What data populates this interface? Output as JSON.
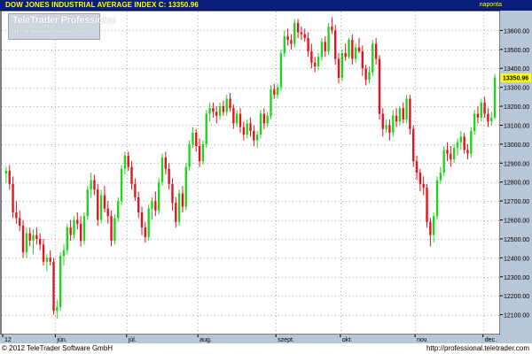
{
  "header": {
    "instrument": "DOW JONES INDUSTRIAL AVERAGE INDEX",
    "close_label": "C:",
    "close_value": "13350.96",
    "period": "naponta"
  },
  "logo": {
    "name": "TeleTrader Professional",
    "url": "http://professional.teletrader.com"
  },
  "footer": {
    "copyright": "© 2012 TeleTrader Software GmbH",
    "url": "http://professional.teletrader.com"
  },
  "colors": {
    "up": "#1fd41f",
    "down": "#e8101c",
    "title_bg": "#0b1f7a",
    "title_text": "#ffff00",
    "axis_bg": "#b8c6d8",
    "last_price_bg": "#ffff00",
    "grid": "#b0b0b0"
  },
  "chart_data": {
    "type": "candlestick",
    "title": "DOW JONES INDUSTRIAL AVERAGE INDEX",
    "last_close": 13350.96,
    "ylim": [
      12000,
      13700
    ],
    "y_ticks": [
      12100,
      12200,
      12300,
      12400,
      12500,
      12600,
      12700,
      12800,
      12900,
      13000,
      13100,
      13200,
      13300,
      13400,
      13500,
      13600
    ],
    "y_tick_labels": [
      "12100.00",
      "12200.00",
      "12300.00",
      "12400.00",
      "12500.00",
      "12600.00",
      "12700.00",
      "12800.00",
      "12900.00",
      "13000.00",
      "13100.00",
      "13200.00",
      "13300.00",
      "13400.00",
      "13500.00",
      "13600.00"
    ],
    "x_ticks": [
      {
        "label": "12",
        "index": 0
      },
      {
        "label": "jún.",
        "index": 15
      },
      {
        "label": "júl.",
        "index": 36
      },
      {
        "label": "aug.",
        "index": 57
      },
      {
        "label": "szept.",
        "index": 80
      },
      {
        "label": "okt.",
        "index": 99
      },
      {
        "label": "nov.",
        "index": 121
      },
      {
        "label": "dec.",
        "index": 141
      }
    ],
    "grid": true,
    "candles": [
      {
        "o": 12845,
        "h": 12880,
        "l": 12795,
        "c": 12860
      },
      {
        "o": 12860,
        "h": 12890,
        "l": 12760,
        "c": 12790
      },
      {
        "o": 12790,
        "h": 12830,
        "l": 12610,
        "c": 12640
      },
      {
        "o": 12640,
        "h": 12700,
        "l": 12580,
        "c": 12610
      },
      {
        "o": 12610,
        "h": 12650,
        "l": 12540,
        "c": 12570
      },
      {
        "o": 12570,
        "h": 12600,
        "l": 12400,
        "c": 12430
      },
      {
        "o": 12430,
        "h": 12560,
        "l": 12400,
        "c": 12530
      },
      {
        "o": 12530,
        "h": 12560,
        "l": 12460,
        "c": 12490
      },
      {
        "o": 12490,
        "h": 12550,
        "l": 12420,
        "c": 12520
      },
      {
        "o": 12520,
        "h": 12560,
        "l": 12470,
        "c": 12500
      },
      {
        "o": 12500,
        "h": 12530,
        "l": 12440,
        "c": 12470
      },
      {
        "o": 12470,
        "h": 12500,
        "l": 12360,
        "c": 12380
      },
      {
        "o": 12380,
        "h": 12420,
        "l": 12330,
        "c": 12400
      },
      {
        "o": 12400,
        "h": 12440,
        "l": 12360,
        "c": 12380
      },
      {
        "o": 12380,
        "h": 12400,
        "l": 12100,
        "c": 12120
      },
      {
        "o": 12120,
        "h": 12180,
        "l": 12080,
        "c": 12140
      },
      {
        "o": 12140,
        "h": 12430,
        "l": 12120,
        "c": 12410
      },
      {
        "o": 12410,
        "h": 12470,
        "l": 12360,
        "c": 12440
      },
      {
        "o": 12440,
        "h": 12580,
        "l": 12420,
        "c": 12560
      },
      {
        "o": 12560,
        "h": 12600,
        "l": 12490,
        "c": 12520
      },
      {
        "o": 12520,
        "h": 12620,
        "l": 12500,
        "c": 12600
      },
      {
        "o": 12600,
        "h": 12640,
        "l": 12550,
        "c": 12580
      },
      {
        "o": 12580,
        "h": 12620,
        "l": 12460,
        "c": 12490
      },
      {
        "o": 12490,
        "h": 12640,
        "l": 12470,
        "c": 12620
      },
      {
        "o": 12620,
        "h": 12780,
        "l": 12600,
        "c": 12760
      },
      {
        "o": 12760,
        "h": 12850,
        "l": 12720,
        "c": 12810
      },
      {
        "o": 12810,
        "h": 12840,
        "l": 12730,
        "c": 12760
      },
      {
        "o": 12760,
        "h": 12790,
        "l": 12570,
        "c": 12600
      },
      {
        "o": 12600,
        "h": 12760,
        "l": 12580,
        "c": 12730
      },
      {
        "o": 12730,
        "h": 12780,
        "l": 12640,
        "c": 12660
      },
      {
        "o": 12660,
        "h": 12700,
        "l": 12580,
        "c": 12620
      },
      {
        "o": 12620,
        "h": 12650,
        "l": 12460,
        "c": 12490
      },
      {
        "o": 12490,
        "h": 12630,
        "l": 12470,
        "c": 12610
      },
      {
        "o": 12610,
        "h": 12720,
        "l": 12590,
        "c": 12700
      },
      {
        "o": 12700,
        "h": 12890,
        "l": 12680,
        "c": 12870
      },
      {
        "o": 12870,
        "h": 12960,
        "l": 12840,
        "c": 12940
      },
      {
        "o": 12940,
        "h": 12960,
        "l": 12860,
        "c": 12880
      },
      {
        "o": 12880,
        "h": 12910,
        "l": 12760,
        "c": 12790
      },
      {
        "o": 12790,
        "h": 12820,
        "l": 12700,
        "c": 12720
      },
      {
        "o": 12720,
        "h": 12750,
        "l": 12610,
        "c": 12640
      },
      {
        "o": 12640,
        "h": 12670,
        "l": 12520,
        "c": 12560
      },
      {
        "o": 12560,
        "h": 12590,
        "l": 12480,
        "c": 12510
      },
      {
        "o": 12510,
        "h": 12680,
        "l": 12490,
        "c": 12660
      },
      {
        "o": 12660,
        "h": 12720,
        "l": 12600,
        "c": 12700
      },
      {
        "o": 12700,
        "h": 12750,
        "l": 12620,
        "c": 12650
      },
      {
        "o": 12650,
        "h": 12820,
        "l": 12630,
        "c": 12800
      },
      {
        "o": 12800,
        "h": 12950,
        "l": 12780,
        "c": 12930
      },
      {
        "o": 12930,
        "h": 12960,
        "l": 12840,
        "c": 12870
      },
      {
        "o": 12870,
        "h": 12900,
        "l": 12760,
        "c": 12790
      },
      {
        "o": 12790,
        "h": 12820,
        "l": 12650,
        "c": 12690
      },
      {
        "o": 12690,
        "h": 12720,
        "l": 12560,
        "c": 12590
      },
      {
        "o": 12590,
        "h": 12760,
        "l": 12570,
        "c": 12740
      },
      {
        "o": 12740,
        "h": 12780,
        "l": 12640,
        "c": 12670
      },
      {
        "o": 12670,
        "h": 12900,
        "l": 12650,
        "c": 12880
      },
      {
        "o": 12880,
        "h": 13020,
        "l": 12860,
        "c": 13000
      },
      {
        "o": 13000,
        "h": 13090,
        "l": 12980,
        "c": 13060
      },
      {
        "o": 13060,
        "h": 13080,
        "l": 12960,
        "c": 12990
      },
      {
        "o": 12990,
        "h": 13030,
        "l": 12880,
        "c": 12910
      },
      {
        "o": 12910,
        "h": 13020,
        "l": 12890,
        "c": 13000
      },
      {
        "o": 13000,
        "h": 13180,
        "l": 12980,
        "c": 13160
      },
      {
        "o": 13160,
        "h": 13220,
        "l": 13120,
        "c": 13190
      },
      {
        "o": 13190,
        "h": 13220,
        "l": 13140,
        "c": 13170
      },
      {
        "o": 13170,
        "h": 13200,
        "l": 13110,
        "c": 13150
      },
      {
        "o": 13150,
        "h": 13220,
        "l": 13130,
        "c": 13200
      },
      {
        "o": 13200,
        "h": 13230,
        "l": 13150,
        "c": 13170
      },
      {
        "o": 13170,
        "h": 13260,
        "l": 13150,
        "c": 13240
      },
      {
        "o": 13240,
        "h": 13270,
        "l": 13170,
        "c": 13190
      },
      {
        "o": 13190,
        "h": 13210,
        "l": 13080,
        "c": 13110
      },
      {
        "o": 13110,
        "h": 13180,
        "l": 13090,
        "c": 13160
      },
      {
        "o": 13160,
        "h": 13190,
        "l": 13060,
        "c": 13090
      },
      {
        "o": 13090,
        "h": 13120,
        "l": 13020,
        "c": 13050
      },
      {
        "o": 13050,
        "h": 13130,
        "l": 13030,
        "c": 13110
      },
      {
        "o": 13110,
        "h": 13140,
        "l": 13040,
        "c": 13070
      },
      {
        "o": 13070,
        "h": 13100,
        "l": 12990,
        "c": 13020
      },
      {
        "o": 13020,
        "h": 13070,
        "l": 12980,
        "c": 13050
      },
      {
        "o": 13050,
        "h": 13180,
        "l": 13030,
        "c": 13160
      },
      {
        "o": 13160,
        "h": 13190,
        "l": 13080,
        "c": 13110
      },
      {
        "o": 13110,
        "h": 13170,
        "l": 13090,
        "c": 13150
      },
      {
        "o": 13150,
        "h": 13310,
        "l": 13130,
        "c": 13290
      },
      {
        "o": 13290,
        "h": 13320,
        "l": 13240,
        "c": 13260
      },
      {
        "o": 13260,
        "h": 13320,
        "l": 13240,
        "c": 13300
      },
      {
        "o": 13300,
        "h": 13500,
        "l": 13280,
        "c": 13480
      },
      {
        "o": 13480,
        "h": 13600,
        "l": 13460,
        "c": 13570
      },
      {
        "o": 13570,
        "h": 13610,
        "l": 13520,
        "c": 13550
      },
      {
        "o": 13550,
        "h": 13580,
        "l": 13500,
        "c": 13530
      },
      {
        "o": 13530,
        "h": 13660,
        "l": 13510,
        "c": 13640
      },
      {
        "o": 13640,
        "h": 13660,
        "l": 13560,
        "c": 13590
      },
      {
        "o": 13590,
        "h": 13620,
        "l": 13550,
        "c": 13580
      },
      {
        "o": 13580,
        "h": 13610,
        "l": 13540,
        "c": 13560
      },
      {
        "o": 13560,
        "h": 13590,
        "l": 13460,
        "c": 13490
      },
      {
        "o": 13490,
        "h": 13530,
        "l": 13400,
        "c": 13430
      },
      {
        "o": 13430,
        "h": 13460,
        "l": 13380,
        "c": 13410
      },
      {
        "o": 13410,
        "h": 13480,
        "l": 13390,
        "c": 13460
      },
      {
        "o": 13460,
        "h": 13560,
        "l": 13440,
        "c": 13540
      },
      {
        "o": 13540,
        "h": 13570,
        "l": 13460,
        "c": 13490
      },
      {
        "o": 13490,
        "h": 13640,
        "l": 13470,
        "c": 13620
      },
      {
        "o": 13620,
        "h": 13670,
        "l": 13580,
        "c": 13600
      },
      {
        "o": 13600,
        "h": 13630,
        "l": 13420,
        "c": 13450
      },
      {
        "o": 13450,
        "h": 13480,
        "l": 13320,
        "c": 13350
      },
      {
        "o": 13350,
        "h": 13500,
        "l": 13330,
        "c": 13480
      },
      {
        "o": 13480,
        "h": 13530,
        "l": 13440,
        "c": 13460
      },
      {
        "o": 13460,
        "h": 13560,
        "l": 13450,
        "c": 13550
      },
      {
        "o": 13550,
        "h": 13580,
        "l": 13420,
        "c": 13450
      },
      {
        "o": 13450,
        "h": 13530,
        "l": 13430,
        "c": 13510
      },
      {
        "o": 13510,
        "h": 13560,
        "l": 13480,
        "c": 13490
      },
      {
        "o": 13490,
        "h": 13520,
        "l": 13360,
        "c": 13400
      },
      {
        "o": 13400,
        "h": 13420,
        "l": 13310,
        "c": 13340
      },
      {
        "o": 13340,
        "h": 13410,
        "l": 13320,
        "c": 13380
      },
      {
        "o": 13380,
        "h": 13550,
        "l": 13360,
        "c": 13530
      },
      {
        "o": 13530,
        "h": 13560,
        "l": 13420,
        "c": 13450
      },
      {
        "o": 13450,
        "h": 13470,
        "l": 13130,
        "c": 13160
      },
      {
        "o": 13160,
        "h": 13190,
        "l": 13040,
        "c": 13080
      },
      {
        "o": 13080,
        "h": 13130,
        "l": 13060,
        "c": 13100
      },
      {
        "o": 13100,
        "h": 13130,
        "l": 13020,
        "c": 13060
      },
      {
        "o": 13060,
        "h": 13180,
        "l": 13040,
        "c": 13150
      },
      {
        "o": 13150,
        "h": 13190,
        "l": 13090,
        "c": 13120
      },
      {
        "o": 13120,
        "h": 13200,
        "l": 13100,
        "c": 13190
      },
      {
        "o": 13190,
        "h": 13220,
        "l": 13110,
        "c": 13130
      },
      {
        "o": 13130,
        "h": 13260,
        "l": 13110,
        "c": 13240
      },
      {
        "o": 13240,
        "h": 13260,
        "l": 13050,
        "c": 13080
      },
      {
        "o": 13080,
        "h": 13100,
        "l": 12880,
        "c": 12910
      },
      {
        "o": 12910,
        "h": 12940,
        "l": 12810,
        "c": 12850
      },
      {
        "o": 12850,
        "h": 12870,
        "l": 12750,
        "c": 12790
      },
      {
        "o": 12790,
        "h": 12830,
        "l": 12730,
        "c": 12770
      },
      {
        "o": 12770,
        "h": 12790,
        "l": 12560,
        "c": 12590
      },
      {
        "o": 12590,
        "h": 12610,
        "l": 12460,
        "c": 12520
      },
      {
        "o": 12520,
        "h": 12640,
        "l": 12480,
        "c": 12620
      },
      {
        "o": 12620,
        "h": 12830,
        "l": 12600,
        "c": 12810
      },
      {
        "o": 12810,
        "h": 12880,
        "l": 12790,
        "c": 12850
      },
      {
        "o": 12850,
        "h": 12990,
        "l": 12830,
        "c": 12970
      },
      {
        "o": 12970,
        "h": 13010,
        "l": 12910,
        "c": 12950
      },
      {
        "o": 12950,
        "h": 12990,
        "l": 12880,
        "c": 12920
      },
      {
        "o": 12920,
        "h": 13000,
        "l": 12900,
        "c": 12980
      },
      {
        "o": 12980,
        "h": 13030,
        "l": 12940,
        "c": 13010
      },
      {
        "o": 13010,
        "h": 13070,
        "l": 12970,
        "c": 13040
      },
      {
        "o": 13040,
        "h": 13060,
        "l": 12950,
        "c": 12970
      },
      {
        "o": 12970,
        "h": 13000,
        "l": 12920,
        "c": 12950
      },
      {
        "o": 12950,
        "h": 13090,
        "l": 12930,
        "c": 13070
      },
      {
        "o": 13070,
        "h": 13180,
        "l": 13050,
        "c": 13160
      },
      {
        "o": 13160,
        "h": 13200,
        "l": 13110,
        "c": 13140
      },
      {
        "o": 13140,
        "h": 13240,
        "l": 13120,
        "c": 13220
      },
      {
        "o": 13220,
        "h": 13250,
        "l": 13140,
        "c": 13160
      },
      {
        "o": 13160,
        "h": 13190,
        "l": 13090,
        "c": 13120
      },
      {
        "o": 13120,
        "h": 13170,
        "l": 13100,
        "c": 13140
      },
      {
        "o": 13140,
        "h": 13370,
        "l": 13130,
        "c": 13351
      }
    ]
  }
}
